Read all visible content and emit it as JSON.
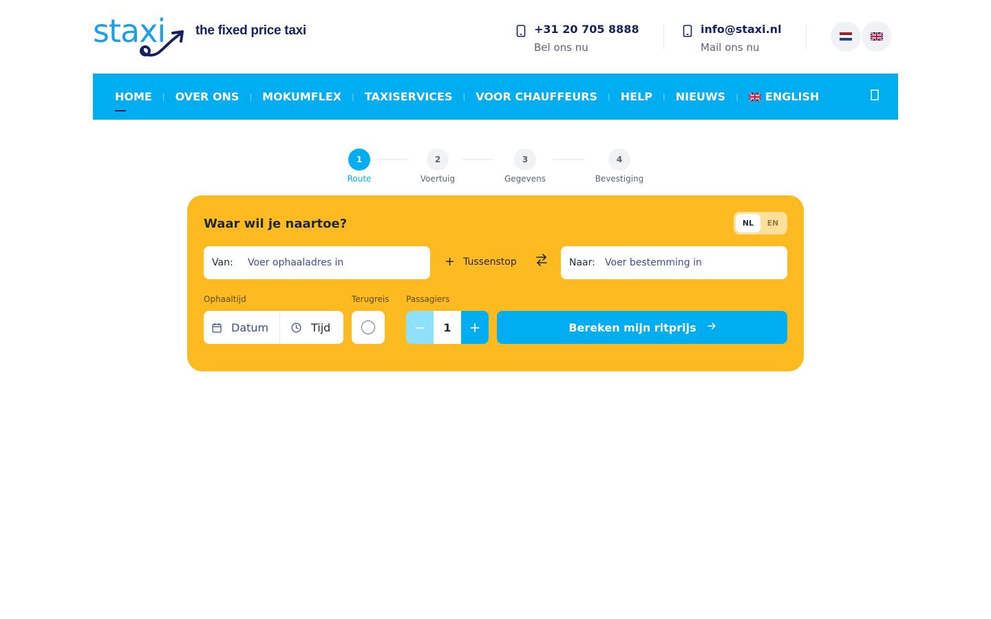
{
  "header": {
    "logo_text": "staxi",
    "tagline": "the fixed price taxi",
    "phone": "+31 20 705 8888",
    "phone_sub": "Bel ons nu",
    "email": "info@staxi.nl",
    "email_sub": "Mail ons nu",
    "icons": {
      "phone": "phone-icon",
      "mail": "mail-icon"
    }
  },
  "nav": {
    "items": [
      {
        "label": "HOME",
        "active": true
      },
      {
        "label": "OVER ONS"
      },
      {
        "label": "MOKUMFLEX"
      },
      {
        "label": "TAXISERVICES"
      },
      {
        "label": "VOOR CHAUFFEURS"
      },
      {
        "label": "HELP"
      },
      {
        "label": "NIEUWS"
      },
      {
        "label": "ENGLISH"
      }
    ],
    "separator": "|"
  },
  "steps": [
    {
      "number": "1",
      "label": "Route",
      "active": true
    },
    {
      "number": "2",
      "label": "Voertuig"
    },
    {
      "number": "3",
      "label": "Gegevens"
    },
    {
      "number": "4",
      "label": "Bevestiging"
    }
  ],
  "booking": {
    "title": "Waar wil je naartoe?",
    "lang_nl": "NL",
    "lang_en": "EN",
    "from_label": "Van:",
    "from_placeholder": "Voer ophaaladres in",
    "stopover": "Tussenstop",
    "to_label": "Naar:",
    "to_placeholder": "Voer bestemming in",
    "pickup_label": "Ophaaltijd",
    "date_placeholder": "Datum",
    "time_placeholder": "Tijd",
    "return_label": "Terugreis",
    "passengers_label": "Passagiers",
    "passengers": "1",
    "minus": "−",
    "plus": "+",
    "submit": "Bereken mijn ritprijs"
  },
  "colors": {
    "primary": "#00adf0",
    "accent": "#fdbb21",
    "navy": "#17215f"
  }
}
